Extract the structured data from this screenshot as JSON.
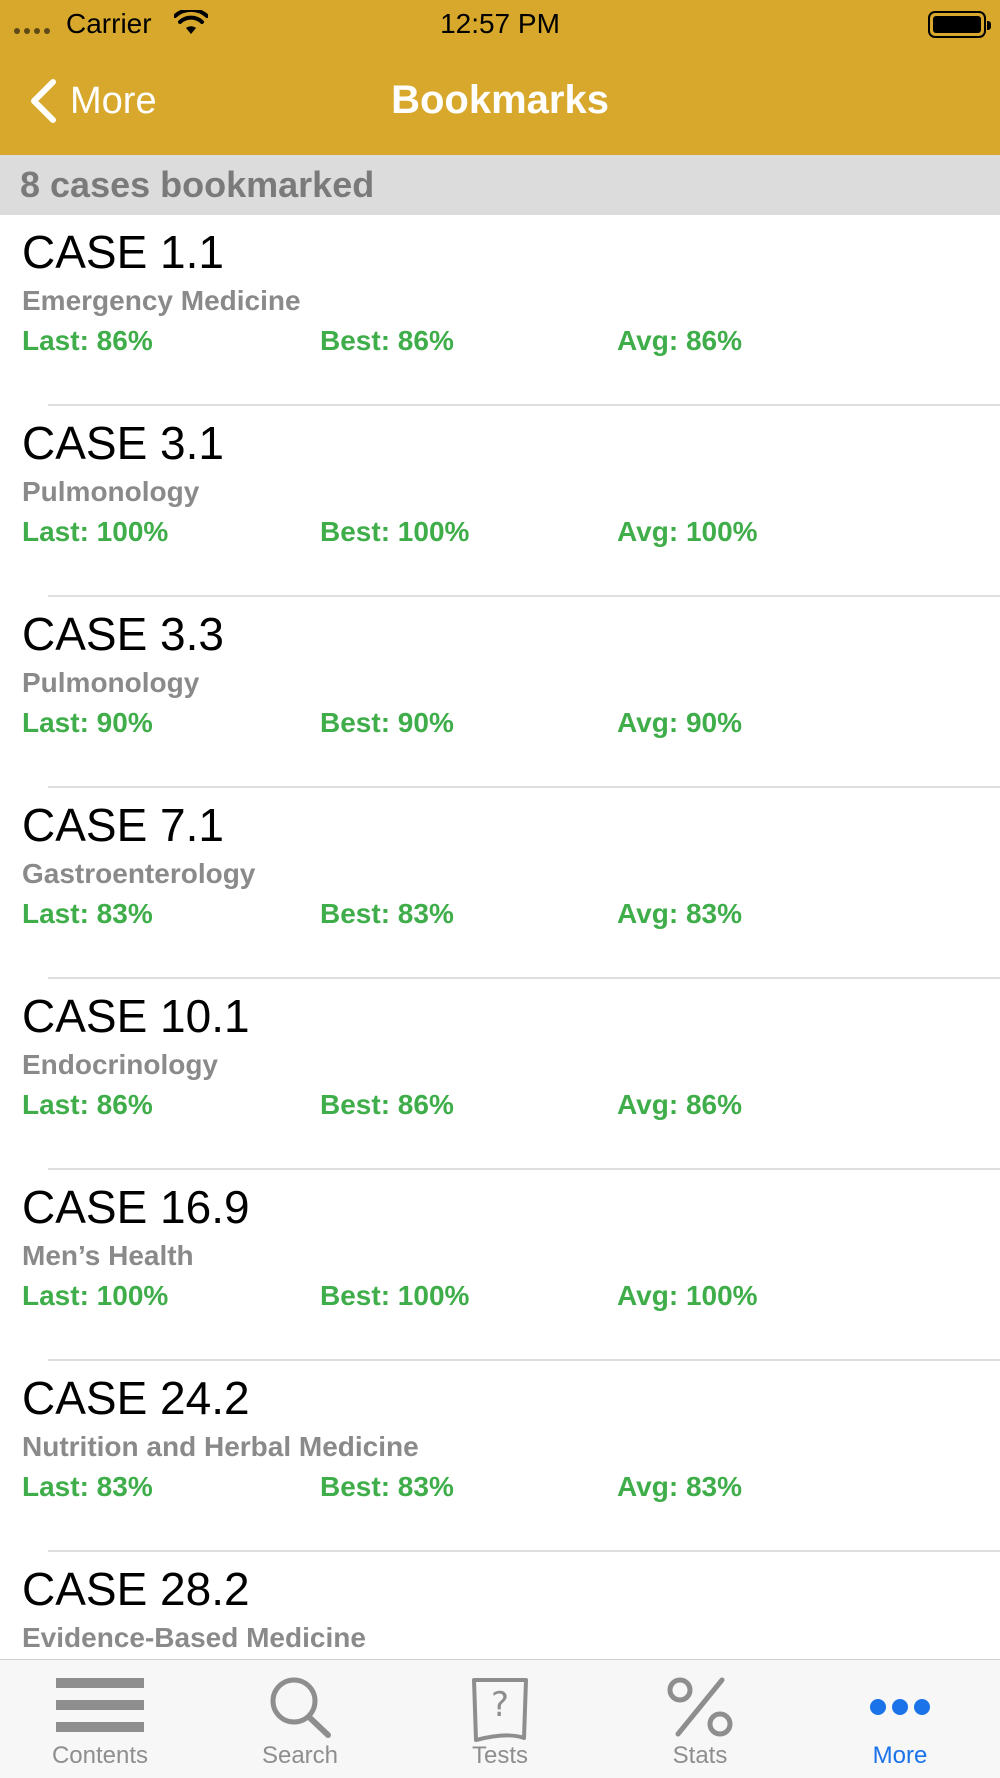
{
  "status_bar": {
    "carrier": "Carrier",
    "time": "12:57 PM"
  },
  "nav": {
    "back_label": "More",
    "title": "Bookmarks"
  },
  "section_header": "8 cases bookmarked",
  "colors": {
    "nav_bg": "#d8a82c",
    "stat_green": "#3fae4a",
    "tab_active": "#1a73e8"
  },
  "cases": [
    {
      "title": "CASE 1.1",
      "category": "Emergency Medicine",
      "last": "Last: 86%",
      "best": "Best: 86%",
      "avg": "Avg: 86%"
    },
    {
      "title": "CASE 3.1",
      "category": "Pulmonology",
      "last": "Last: 100%",
      "best": "Best: 100%",
      "avg": "Avg: 100%"
    },
    {
      "title": "CASE 3.3",
      "category": "Pulmonology",
      "last": "Last: 90%",
      "best": "Best: 90%",
      "avg": "Avg: 90%"
    },
    {
      "title": "CASE 7.1",
      "category": "Gastroenterology",
      "last": "Last: 83%",
      "best": "Best: 83%",
      "avg": "Avg: 83%"
    },
    {
      "title": "CASE 10.1",
      "category": "Endocrinology",
      "last": "Last: 86%",
      "best": "Best: 86%",
      "avg": "Avg: 86%"
    },
    {
      "title": "CASE 16.9",
      "category": "Men’s Health",
      "last": "Last: 100%",
      "best": "Best: 100%",
      "avg": "Avg: 100%"
    },
    {
      "title": "CASE 24.2",
      "category": "Nutrition and Herbal Medicine",
      "last": "Last: 83%",
      "best": "Best: 83%",
      "avg": "Avg: 83%"
    },
    {
      "title": "CASE 28.2",
      "category": "Evidence-Based Medicine",
      "last": "",
      "best": "",
      "avg": ""
    }
  ],
  "tabs": [
    {
      "label": "Contents",
      "icon": "list-icon",
      "active": false
    },
    {
      "label": "Search",
      "icon": "search-icon",
      "active": false
    },
    {
      "label": "Tests",
      "icon": "question-page-icon",
      "active": false
    },
    {
      "label": "Stats",
      "icon": "percent-icon",
      "active": false
    },
    {
      "label": "More",
      "icon": "more-dots-icon",
      "active": true
    }
  ]
}
